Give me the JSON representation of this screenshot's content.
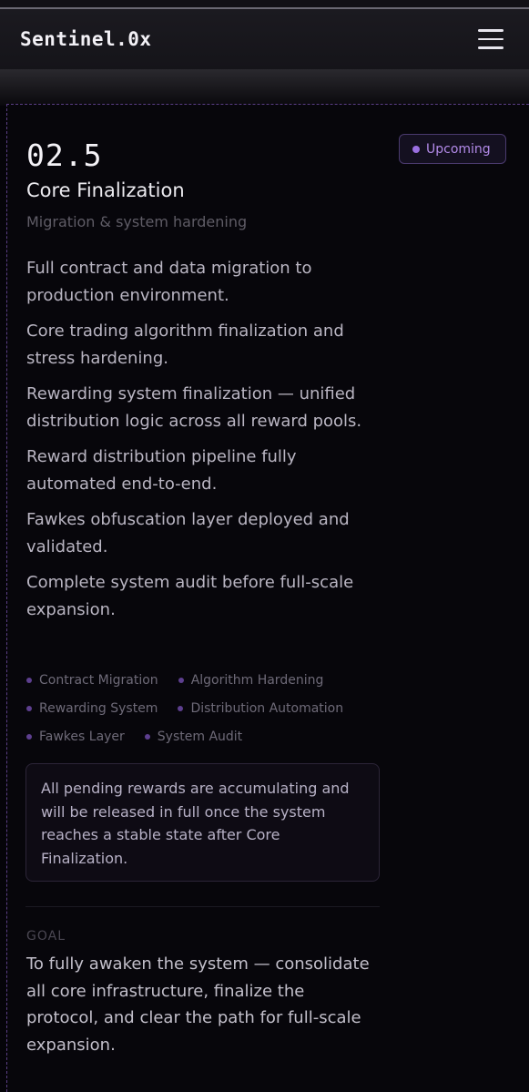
{
  "header": {
    "brand": "Sentinel.0x",
    "menu_icon": "hamburger-menu-icon"
  },
  "phase": {
    "number": "02.5",
    "status": "Upcoming",
    "title": "Core Finalization",
    "subtitle": "Migration & system hardening",
    "items": [
      "Full contract and data migration to production environment.",
      "Core trading algorithm finalization and stress hardening.",
      "Rewarding system finalization — unified distribution logic across all reward pools.",
      "Reward distribution pipeline fully automated end-to-end.",
      "Fawkes obfuscation layer deployed and validated.",
      "Complete system audit before full-scale expansion."
    ],
    "tags": [
      "Contract Migration",
      "Algorithm Hardening",
      "Rewarding System",
      "Distribution Automation",
      "Fawkes Layer",
      "System Audit"
    ],
    "notice": "All pending rewards are accumulating and will be released in full once the system reaches a stable state after Core Finalization.",
    "goal_label": "GOAL",
    "goal_text": "To fully awaken the system — consolidate all core infrastructure, finalize the protocol, and clear the path for full-scale expansion."
  },
  "colors": {
    "accent": "#9a6fe0",
    "background": "#050409"
  }
}
